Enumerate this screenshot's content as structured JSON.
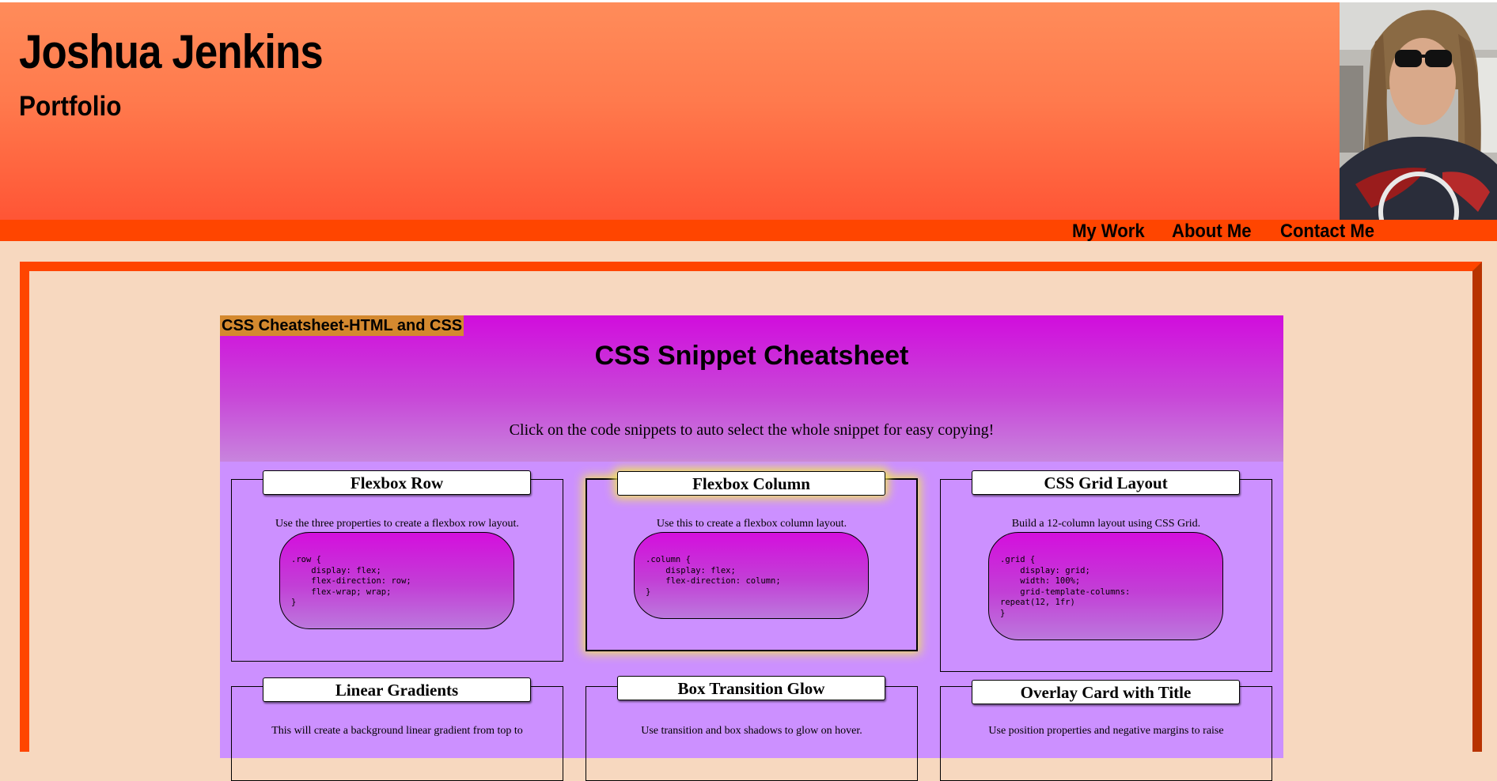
{
  "header": {
    "name": "Joshua Jenkins",
    "subtitle": "Portfolio",
    "avatar_alt": "profile photo"
  },
  "nav": [
    {
      "label": "My Work"
    },
    {
      "label": "About Me"
    },
    {
      "label": "Contact Me"
    }
  ],
  "project": {
    "tag": "CSS Cheatsheet-HTML and CSS",
    "title": "CSS Snippet Cheatsheet",
    "instruction": "Click on the code snippets to auto select the whole snippet for easy copying!",
    "cards": [
      {
        "title": "Flexbox Row",
        "description": "Use the three properties to create a flexbox row layout.",
        "code": ".row {\n    display: flex;\n    flex-direction: row;\n    flex-wrap; wrap;\n}"
      },
      {
        "title": "Flexbox Column",
        "description": "Use this to create a flexbox column layout.",
        "code": ".column {\n    display: flex;\n    flex-direction: column;\n}"
      },
      {
        "title": "CSS Grid Layout",
        "description": "Build a 12-column layout using CSS Grid.",
        "code": ".grid {\n    display: grid;\n    width: 100%;\n    grid-template-columns:\nrepeat(12, 1fr)\n}"
      },
      {
        "title": "Linear Gradients",
        "description": "This will create a background linear gradient from top to"
      },
      {
        "title": "Box Transition Glow",
        "description": "Use transition and box shadows to glow on hover."
      },
      {
        "title": "Overlay Card with Title",
        "description": "Use position properties and negative margins to raise"
      }
    ]
  },
  "colors": {
    "page_bg": "#f7d8bf",
    "accent": "#ff4500",
    "panel_bg": "#cc90ff",
    "tag_bg": "#d4892f",
    "glow": "#f0e060"
  }
}
